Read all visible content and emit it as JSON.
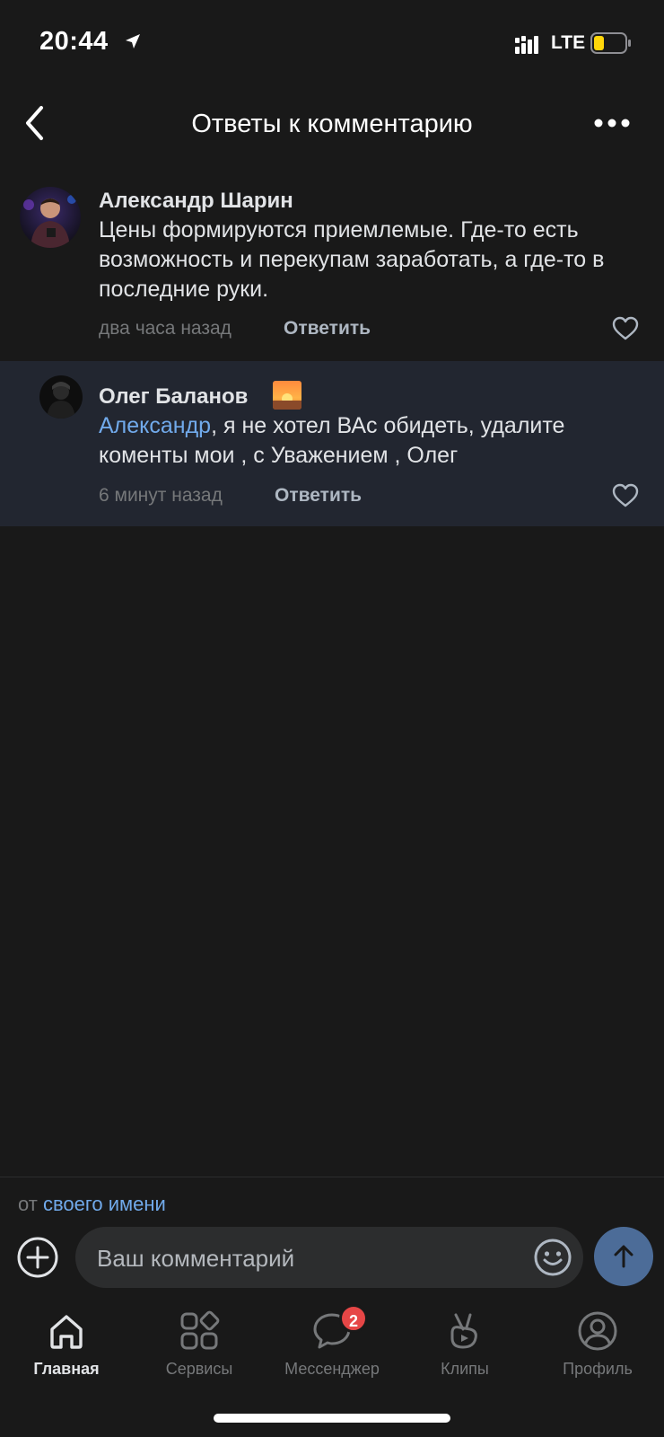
{
  "status_bar": {
    "time": "20:44",
    "network": "LTE"
  },
  "nav": {
    "title": "Ответы к комментарию"
  },
  "comments": [
    {
      "author": "Александр Шарин",
      "text": "Цены формируются приемлемые.  Где-то есть возможность и перекупам заработать, а где-то в последние руки.",
      "time": "два часа назад",
      "reply": "Ответить"
    },
    {
      "author": "Олег Баланов",
      "mention": "Александр",
      "text": ", я не хотел ВАс обидеть, удалите коменты мои , с Уважением , Олег",
      "time": "6 минут назад",
      "reply": "Ответить"
    }
  ],
  "composer": {
    "from_prefix": "от",
    "from_link": "своего имени",
    "placeholder": "Ваш комментарий"
  },
  "tabs": [
    {
      "label": "Главная",
      "icon": "home-icon"
    },
    {
      "label": "Сервисы",
      "icon": "services-icon"
    },
    {
      "label": "Мессенджер",
      "icon": "messenger-icon",
      "badge": "2"
    },
    {
      "label": "Клипы",
      "icon": "clips-icon"
    },
    {
      "label": "Профиль",
      "icon": "profile-icon"
    }
  ],
  "colors": {
    "background": "#191919",
    "accent": "#71aaeb",
    "highlight_row": "#222630",
    "badge": "#e64646",
    "send": "#4c6c98"
  }
}
